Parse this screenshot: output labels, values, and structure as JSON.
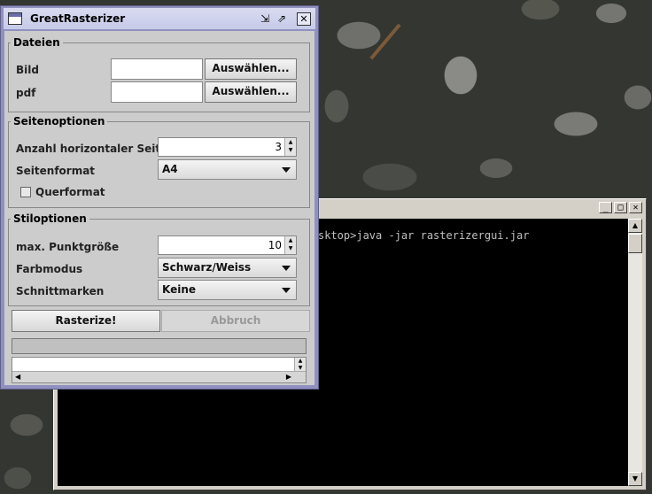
{
  "console": {
    "command_line": "sktop>java -jar rasterizergui.jar",
    "min_symbol": "_",
    "max_symbol": "□",
    "close_symbol": "✕"
  },
  "frame": {
    "title": "GreatRasterizer",
    "minimize_symbol": "⇲",
    "maximize_symbol": "⇗",
    "close_symbol": "✕"
  },
  "dateien": {
    "title": "Dateien",
    "bild_label": "Bild",
    "bild_value": "",
    "bild_button": "Auswählen...",
    "pdf_label": "pdf",
    "pdf_value": "",
    "pdf_button": "Auswählen..."
  },
  "seitenoptionen": {
    "title": "Seitenoptionen",
    "horizontal_label": "Anzahl horizontaler Seiten",
    "horizontal_value": "3",
    "format_label": "Seitenformat",
    "format_value": "A4",
    "querformat_label": "Querformat",
    "querformat_checked": false
  },
  "stiloptionen": {
    "title": "Stiloptionen",
    "punkt_label": "max. Punktgröße",
    "punkt_value": "10",
    "farbmodus_label": "Farbmodus",
    "farbmodus_value": "Schwarz/Weiss",
    "schnittmarken_label": "Schnittmarken",
    "schnittmarken_value": "Keine"
  },
  "actions": {
    "rasterize_label": "Rasterize!",
    "abbruch_label": "Abbruch"
  },
  "progress": {
    "value": 0
  },
  "log": {
    "text": ""
  }
}
